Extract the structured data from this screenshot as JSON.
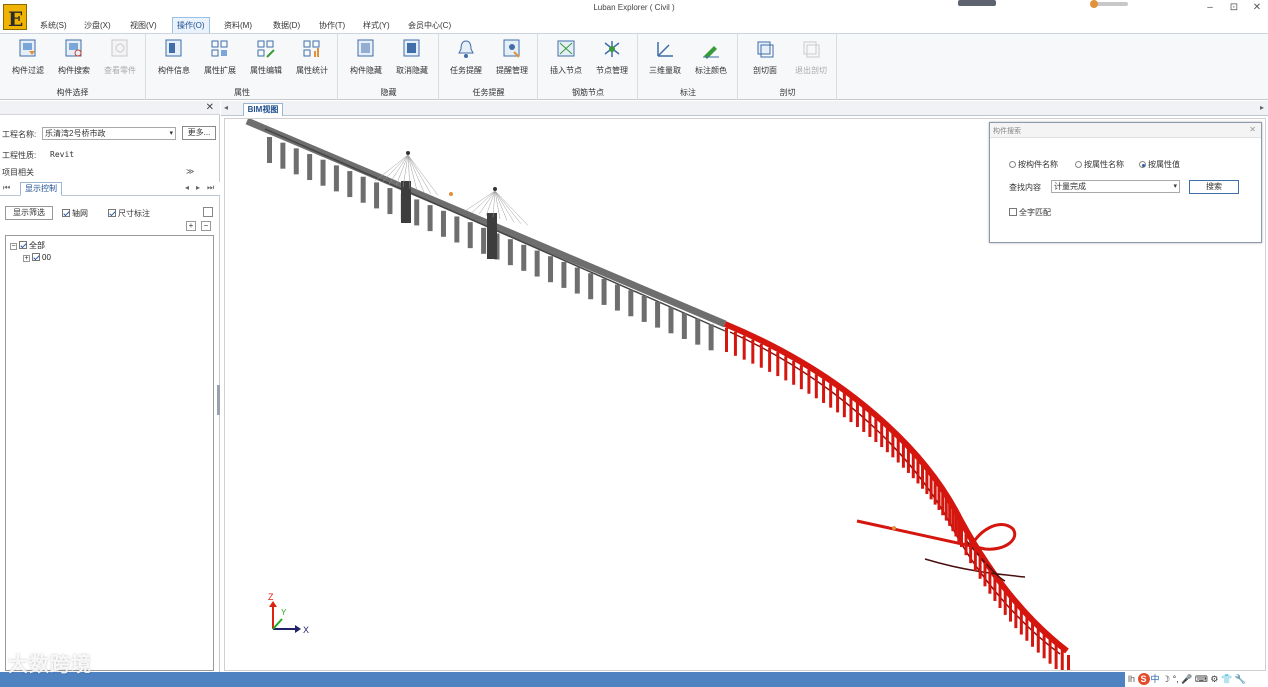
{
  "app": {
    "title": "Luban Explorer ( Civil )",
    "logo_letter": "E",
    "window_controls": [
      "–",
      "⊡",
      "✕"
    ]
  },
  "menu": {
    "items": [
      "系统(S)",
      "沙盘(X)",
      "视图(V)",
      "操作(O)",
      "资料(M)",
      "数据(D)",
      "协作(T)",
      "样式(Y)",
      "会员中心(C)"
    ],
    "active": "操作(O)"
  },
  "ribbon": {
    "groups": [
      {
        "label": "构件选择",
        "buttons": [
          {
            "label": "构件过滤",
            "icon": "component-filter-icon"
          },
          {
            "label": "构件搜索",
            "icon": "component-search-icon"
          },
          {
            "label": "查看零件",
            "icon": "view-parts-icon",
            "disabled": true
          }
        ]
      },
      {
        "label": "属性",
        "buttons": [
          {
            "label": "构件信息",
            "icon": "component-info-icon"
          },
          {
            "label": "属性扩展",
            "icon": "attribute-extend-icon"
          },
          {
            "label": "属性编辑",
            "icon": "attribute-edit-icon"
          },
          {
            "label": "属性统计",
            "icon": "attribute-stats-icon"
          }
        ]
      },
      {
        "label": "隐藏",
        "buttons": [
          {
            "label": "构件隐藏",
            "icon": "hide-component-icon"
          },
          {
            "label": "取消隐藏",
            "icon": "unhide-icon"
          }
        ]
      },
      {
        "label": "任务提醒",
        "buttons": [
          {
            "label": "任务提醒",
            "icon": "bell-icon"
          },
          {
            "label": "提醒管理",
            "icon": "reminder-manage-icon"
          }
        ]
      },
      {
        "label": "钢筋节点",
        "buttons": [
          {
            "label": "插入节点",
            "icon": "insert-node-icon"
          },
          {
            "label": "节点管理",
            "icon": "node-manage-icon"
          }
        ]
      },
      {
        "label": "标注",
        "buttons": [
          {
            "label": "三维量取",
            "icon": "3d-measure-icon"
          },
          {
            "label": "标注颜色",
            "icon": "annotation-color-icon"
          }
        ]
      },
      {
        "label": "剖切",
        "buttons": [
          {
            "label": "剖切面",
            "icon": "section-plane-icon"
          },
          {
            "label": "退出剖切",
            "icon": "exit-section-icon",
            "disabled": true
          }
        ]
      }
    ]
  },
  "left_panel": {
    "project_name_label": "工程名称:",
    "project_name_value": "乐清湾2号桥市政",
    "more_button": "更多...",
    "project_type_label": "工程性质:",
    "project_type_value": "Revit",
    "project_related_label": "项目相关",
    "tab_label": "显示控制",
    "filter_button": "显示筛选",
    "axis_checkbox": "轴网",
    "dimension_checkbox": "尺寸标注",
    "tree": [
      {
        "label": "全部",
        "expanded": true
      },
      {
        "label": "00",
        "expanded": false
      }
    ]
  },
  "doc_tab": {
    "label": "BIM视图"
  },
  "search_panel": {
    "title": "构件搜索",
    "radios": [
      {
        "label": "按构件名称",
        "checked": false
      },
      {
        "label": "按属性名称",
        "checked": false
      },
      {
        "label": "按属性值",
        "checked": true
      }
    ],
    "content_label": "查找内容",
    "content_value": "计量完成",
    "search_button": "搜索",
    "full_match": "全字匹配"
  },
  "viewport": {
    "axes": {
      "x": "X",
      "y": "Y",
      "z": "Z"
    },
    "colors": {
      "gray_structure": "#6e6e6e",
      "highlighted": "#d4160f"
    }
  },
  "status": {
    "watermark": "大数跨境",
    "ime_prefix": "lh",
    "ime_logo": "S",
    "ime_lang": "中"
  }
}
